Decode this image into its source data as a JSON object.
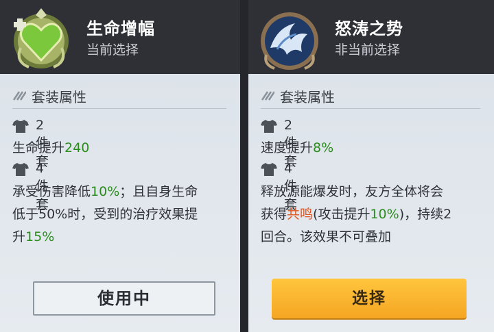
{
  "left_card": {
    "name": "生命增幅",
    "status": "当前选择",
    "section_title": "套装属性",
    "piece2_label": "2件套",
    "piece2_text": "生命提升",
    "piece2_value": "240",
    "piece4_label": "4件套",
    "piece4_line1_a": "承受伤害降低",
    "piece4_line1_b": "10%",
    "piece4_line1_c": "；且自身生命",
    "piece4_line2": "低于50%时，受到的治疗效果提",
    "piece4_line3_a": "升",
    "piece4_line3_b": "15%",
    "button": "使用中"
  },
  "right_card": {
    "name": "怒涛之势",
    "status": "非当前选择",
    "section_title": "套装属性",
    "piece2_label": "2件套",
    "piece2_text": "速度提升",
    "piece2_value": "8%",
    "piece4_label": "4件套",
    "piece4_line1": "释放源能爆发时，友方全体将会",
    "piece4_line2_a": "获得",
    "piece4_line2_b": "共鸣",
    "piece4_line2_c": "(攻击提升",
    "piece4_line2_d": "10%",
    "piece4_line2_e": ")，持续2",
    "piece4_line3": "回合。该效果不可叠加",
    "button": "选择"
  },
  "colors": {
    "highlight_green": "#2a8d1c",
    "highlight_orange": "#e2531d",
    "select_button": "#f5a623",
    "header_bg": "#2f3036"
  },
  "icons": {
    "left_emblem": "green-heart-emblem-icon",
    "right_emblem": "blue-wave-emblem-icon",
    "section": "stripes-icon",
    "piece": "shirt-icon"
  }
}
